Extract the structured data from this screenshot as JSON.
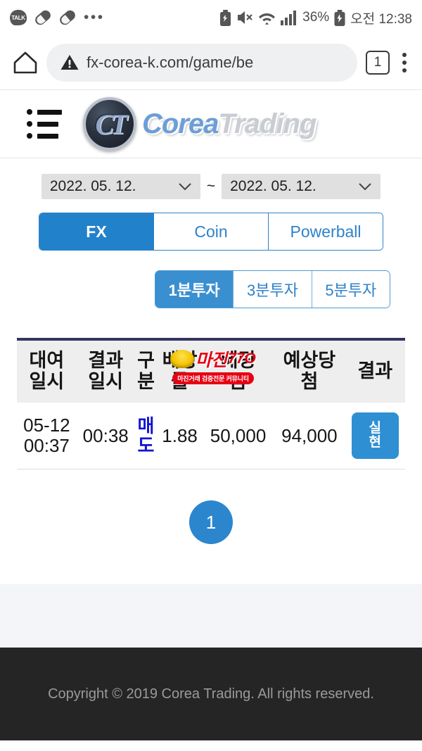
{
  "statusbar": {
    "left_icons": [
      "kakaotalk-icon",
      "pill-icon",
      "pill-icon",
      "overflow-dots-icon"
    ],
    "dots": "•••",
    "kakao_label": "TALK",
    "right_icons": [
      "battery-saver-icon",
      "mute-icon",
      "wifi-icon",
      "signal-icon",
      "charging-battery-icon"
    ],
    "battery_percent": "36%",
    "clock": "오전 12:38"
  },
  "browser": {
    "home_icon": "home-icon",
    "security_icon": "warning-triangle-icon",
    "url": "fx-corea-k.com/game/be",
    "tab_count": "1",
    "menu_icon": "kebab-menu-icon"
  },
  "site_header": {
    "menu_icon": "hamburger-menu-icon",
    "logo_monogram": "CT",
    "brand_primary": "Corea",
    "brand_secondary": "Trading"
  },
  "filters": {
    "date_from": "2022. 05. 12.",
    "date_to": "2022. 05. 12.",
    "separator": "~",
    "game_tabs": [
      {
        "label": "FX",
        "active": true
      },
      {
        "label": "Coin",
        "active": false
      },
      {
        "label": "Powerball",
        "active": false
      }
    ],
    "interval_tabs": [
      {
        "label": "1분투자",
        "active": true
      },
      {
        "label": "3분투자",
        "active": false
      },
      {
        "label": "5분투자",
        "active": false
      }
    ]
  },
  "table": {
    "headers": [
      {
        "line1": "대여",
        "line2": "일시"
      },
      {
        "line1": "결과",
        "line2": "일시"
      },
      {
        "line1": "구",
        "line2": "분"
      },
      {
        "line1": "배당",
        "line2": "률"
      },
      {
        "line1": "베팅",
        "line2": "금"
      },
      {
        "line1": "예상당",
        "line2": "첨"
      },
      {
        "line1": "결과",
        "line2": ""
      }
    ],
    "rows": [
      {
        "lend_date": "05-12",
        "lend_time": "00:37",
        "result_time": "00:38",
        "type_line1": "매",
        "type_line2": "도",
        "odds": "1.88",
        "bet_amount": "50,000",
        "expected_win": "94,000",
        "result_button": {
          "line1": "실",
          "line2": "현"
        }
      }
    ]
  },
  "watermark": {
    "big_text": "마진",
    "small_text": "마진거래 검증전문 커뮤니티",
    "accent": "77O"
  },
  "pagination": {
    "current": "1"
  },
  "footer": {
    "copyright": "Copyright © 2019 Corea Trading. All rights reserved."
  },
  "colors": {
    "accent_blue": "#2281cb",
    "table_top_border": "#35355f",
    "sell_blue": "#1414cf",
    "footer_bg": "#252525",
    "watermark_red": "#e60012"
  }
}
